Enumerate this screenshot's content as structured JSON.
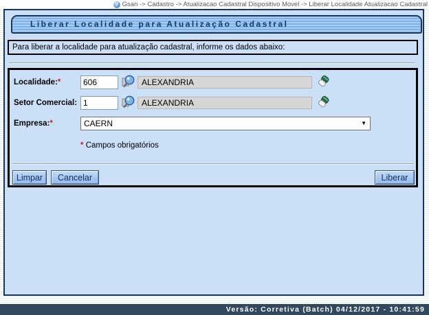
{
  "colors": {
    "panel_bg": "#cbdff7",
    "titlebar_stripe_light": "#a9ccf3",
    "titlebar_stripe_dark": "#7fb0e6",
    "border_navy": "#16355d",
    "box_border_black": "#000000",
    "statusbar_bg": "#32485e",
    "required_red": "#d02020",
    "readonly_field_bg": "#d6d6d6",
    "button_bg": "#a5c8f0"
  },
  "breadcrumb": {
    "help_icon_glyph": "?",
    "path": "Gsan -> Cadastro -> Atualizacao Cadastral Dispositivo Movel -> Liberar Localidade Atualizacao Cadastral"
  },
  "page": {
    "title": "Liberar Localidade para Atualização Cadastral",
    "instruction": "Para liberar a localidade para atualização cadastral, informe os dados abaixo:"
  },
  "form": {
    "localidade": {
      "label": "Localidade:",
      "required_mark": "*",
      "code": "606",
      "name": "ALEXANDRIA"
    },
    "setor_comercial": {
      "label": "Setor Comercial:",
      "code": "1",
      "name": "ALEXANDRIA"
    },
    "empresa": {
      "label": "Empresa:",
      "required_mark": "*",
      "selected_option": "CAERN",
      "dropdown_arrow": "▼"
    },
    "required_note": {
      "mark": "*",
      "text": "Campos obrigatórios"
    }
  },
  "buttons": {
    "limpar": "Limpar",
    "cancelar": "Cancelar",
    "liberar": "Liberar"
  },
  "statusbar": {
    "version_text": "Versão: Corretiva (Batch) 04/12/2017 - 10:41:59"
  }
}
